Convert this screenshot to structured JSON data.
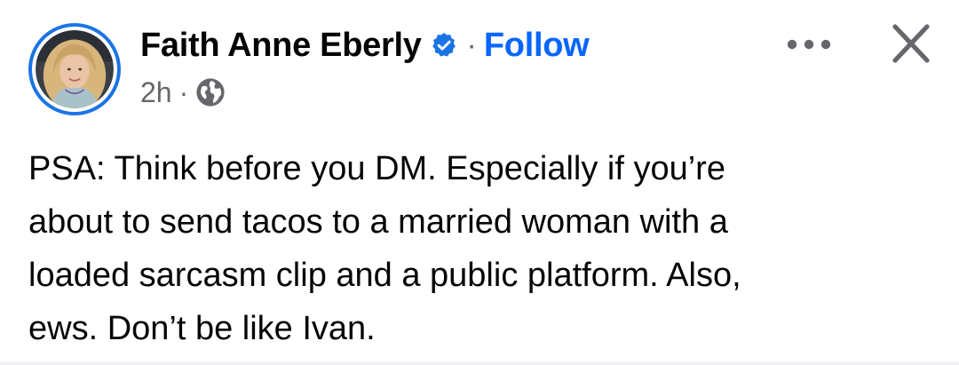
{
  "post": {
    "author_name": "Faith Anne Eberly",
    "verified": true,
    "separator": "·",
    "follow_label": "Follow",
    "timestamp": "2h",
    "meta_separator": "·",
    "audience_icon": "globe-icon",
    "text": "PSA: Think before you DM. Especially if you’re\nabout to send tacos to a married woman with a\nloaded sarcasm clip and a public platform. Also,\news.  Don’t be like Ivan."
  },
  "actions": {
    "more_icon": "more-options-icon",
    "close_icon": "close-icon"
  },
  "colors": {
    "accent": "#0866ff",
    "verified_badge": "#1b74e4",
    "secondary_text": "#65676b",
    "primary_text": "#050505",
    "avatar_ring": "#1b74e4"
  }
}
